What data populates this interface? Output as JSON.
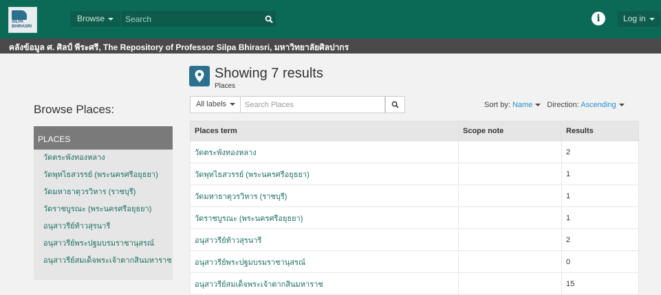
{
  "header": {
    "logo_text": "SILPA BHIRASRI",
    "browse_label": "Browse",
    "search_placeholder": "Search",
    "login_label": "Log in"
  },
  "subbar_text": "คลังข้อมูล ศ. ศิลป์ พีระศรี, The Repository of Professor Silpa Bhirasri, มหาวิทยาลัยศิลปากร",
  "sidebar": {
    "title": "Browse Places:",
    "section_label": "PLACES",
    "items": [
      "วัดตระพังทองหลาง",
      "วัดพุทไธสวรรย์ (พระนครศรีอยุธยา)",
      "วัดมหาธาตุวรวิหาร (ราชบุรี)",
      "วัดราชบูรณะ (พระนครศรีอยุธยา)",
      "อนุสาวรีย์ท้าวสุรนารี",
      "อนุสาวรีย์พระปฐมบรมราชานุสรณ์",
      "อนุสาวรีย์สมเด็จพระเจ้าตากสินมหาราช"
    ]
  },
  "results": {
    "title": "Showing 7 results",
    "subtitle": "Places",
    "labels_select": "All labels",
    "search_placeholder": "Search Places",
    "sort_by_label": "Sort by:",
    "sort_by_value": "Name",
    "direction_label": "Direction:",
    "direction_value": "Ascending"
  },
  "table": {
    "headers": [
      "Places term",
      "Scope note",
      "Results"
    ],
    "rows": [
      {
        "term": "วัดตระพังทองหลาง",
        "scope": "",
        "results": "2"
      },
      {
        "term": "วัดพุทไธสวรรย์ (พระนครศรีอยุธยา)",
        "scope": "",
        "results": "1"
      },
      {
        "term": "วัดมหาธาตุวรวิหาร (ราชบุรี)",
        "scope": "",
        "results": "1"
      },
      {
        "term": "วัดราชบูรณะ (พระนครศรีอยุธยา)",
        "scope": "",
        "results": "1"
      },
      {
        "term": "อนุสาวรีย์ท้าวสุรนารี",
        "scope": "",
        "results": "2"
      },
      {
        "term": "อนุสาวรีย์พระปฐมบรมราชานุสรณ์",
        "scope": "",
        "results": "0"
      },
      {
        "term": "อนุสาวรีย์สมเด็จพระเจ้าตากสินมหาราช",
        "scope": "",
        "results": "15"
      }
    ]
  },
  "colors": {
    "header_green": "#0a6a55",
    "link_teal": "#1c6f64",
    "accent_blue": "#2a8fcf"
  },
  "icons": [
    "search-icon",
    "info-icon",
    "map-marker-icon",
    "caret-down-icon"
  ]
}
